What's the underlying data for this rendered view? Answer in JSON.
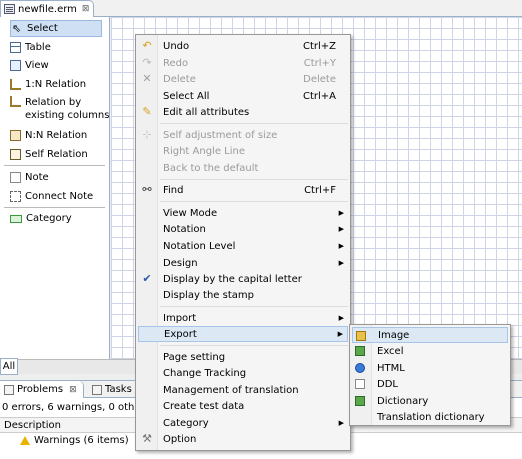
{
  "editor": {
    "tab_title": "newfile.erm",
    "close_glyph": "⊠"
  },
  "palette": {
    "items": [
      {
        "label": "Select",
        "icon": "arrow-icon"
      },
      {
        "label": "Table",
        "icon": "table-icon"
      },
      {
        "label": "View",
        "icon": "view-icon"
      },
      {
        "label": "1:N Relation",
        "icon": "relation-icon"
      },
      {
        "label": "Relation by",
        "label2": "existing columns",
        "icon": "relation-existing-icon"
      },
      {
        "label": "N:N Relation",
        "icon": "nn-relation-icon"
      },
      {
        "label": "Self Relation",
        "icon": "self-relation-icon"
      },
      {
        "label": "Note",
        "icon": "note-icon"
      },
      {
        "label": "Connect Note",
        "icon": "connect-note-icon"
      },
      {
        "label": "Category",
        "icon": "category-icon"
      }
    ],
    "bottom_tab": "All"
  },
  "context_menu": {
    "items": [
      {
        "label": "Undo",
        "shortcut": "Ctrl+Z",
        "icon": "undo-icon",
        "disabled": false
      },
      {
        "label": "Redo",
        "shortcut": "Ctrl+Y",
        "icon": "redo-icon",
        "disabled": true
      },
      {
        "label": "Delete",
        "shortcut": "Delete",
        "icon": "delete-icon",
        "disabled": true
      },
      {
        "label": "Select All",
        "shortcut": "Ctrl+A",
        "disabled": false
      },
      {
        "label": "Edit all attributes",
        "icon": "pencil-icon",
        "disabled": false
      },
      {
        "label": "Self adjustment of size",
        "icon": "resize-icon",
        "disabled": true
      },
      {
        "label": "Right Angle Line",
        "disabled": true
      },
      {
        "label": "Back to the default",
        "disabled": true
      },
      {
        "label": "Find",
        "shortcut": "Ctrl+F",
        "icon": "binoculars-icon",
        "disabled": false
      },
      {
        "label": "View Mode",
        "submenu": true
      },
      {
        "label": "Notation",
        "submenu": true
      },
      {
        "label": "Notation Level",
        "submenu": true
      },
      {
        "label": "Design",
        "submenu": true
      },
      {
        "label": "Display by the capital letter",
        "icon": "check-icon"
      },
      {
        "label": "Display the stamp"
      },
      {
        "label": "Import",
        "submenu": true
      },
      {
        "label": "Export",
        "submenu": true,
        "highlighted": true
      },
      {
        "label": "Page setting"
      },
      {
        "label": "Change Tracking"
      },
      {
        "label": "Management of translation"
      },
      {
        "label": "Create test data"
      },
      {
        "label": "Category",
        "submenu": true
      },
      {
        "label": "Option",
        "icon": "wrench-icon"
      }
    ]
  },
  "export_submenu": {
    "items": [
      {
        "label": "Image",
        "icon": "image-icon",
        "highlighted": true
      },
      {
        "label": "Excel",
        "icon": "excel-icon"
      },
      {
        "label": "HTML",
        "icon": "html-icon"
      },
      {
        "label": "DDL",
        "icon": "ddl-icon"
      },
      {
        "label": "Dictionary",
        "icon": "dictionary-icon"
      },
      {
        "label": "Translation dictionary"
      }
    ]
  },
  "problems_view": {
    "tabs": [
      {
        "label": "Problems",
        "active": true,
        "close_glyph": "⊠"
      },
      {
        "label": "Tasks",
        "active": false
      }
    ],
    "summary": "0 errors, 6 warnings, 0 others",
    "column_header": "Description",
    "rows": [
      {
        "label": "Warnings (6 items)",
        "icon": "warning-icon"
      }
    ]
  },
  "colors": {
    "selection": "#cfe0f5",
    "menu_hover": "#dde8f5",
    "grid_line": "#cfd3e6",
    "frame_border": "#9bb0c8"
  }
}
